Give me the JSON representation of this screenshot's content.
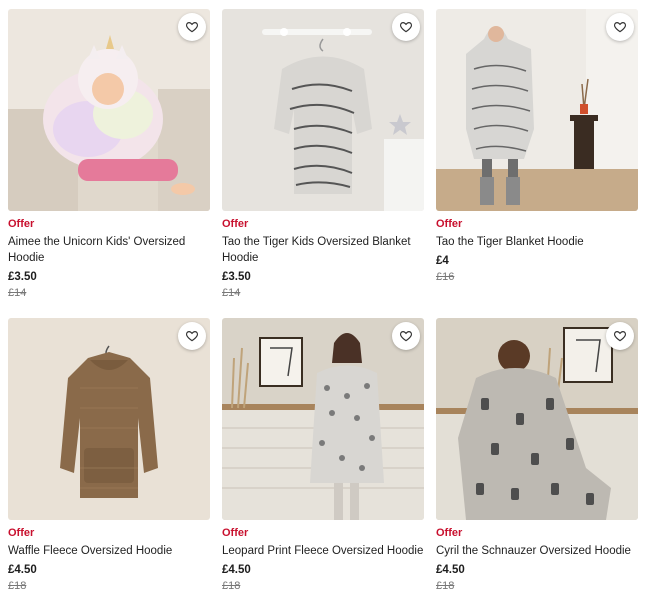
{
  "colors": {
    "offer": "#c8102e",
    "text": "#222222",
    "was": "#777777"
  },
  "products": [
    {
      "badge": "Offer",
      "title": "Aimee the Unicorn Kids' Oversized Hoodie",
      "price": "£3.50",
      "was_price": "£14",
      "icon": "heart-icon"
    },
    {
      "badge": "Offer",
      "title": "Tao the Tiger Kids Oversized Blanket Hoodie",
      "price": "£3.50",
      "was_price": "£14",
      "icon": "heart-icon"
    },
    {
      "badge": "Offer",
      "title": "Tao the Tiger Blanket Hoodie",
      "price": "£4",
      "was_price": "£16",
      "icon": "heart-icon"
    },
    {
      "badge": "Offer",
      "title": "Waffle Fleece Oversized Hoodie",
      "price": "£4.50",
      "was_price": "£18",
      "icon": "heart-icon"
    },
    {
      "badge": "Offer",
      "title": "Leopard Print Fleece Oversized Hoodie",
      "price": "£4.50",
      "was_price": "£18",
      "icon": "heart-icon"
    },
    {
      "badge": "Offer",
      "title": "Cyril the Schnauzer Oversized Hoodie",
      "price": "£4.50",
      "was_price": "£18",
      "icon": "heart-icon"
    }
  ]
}
